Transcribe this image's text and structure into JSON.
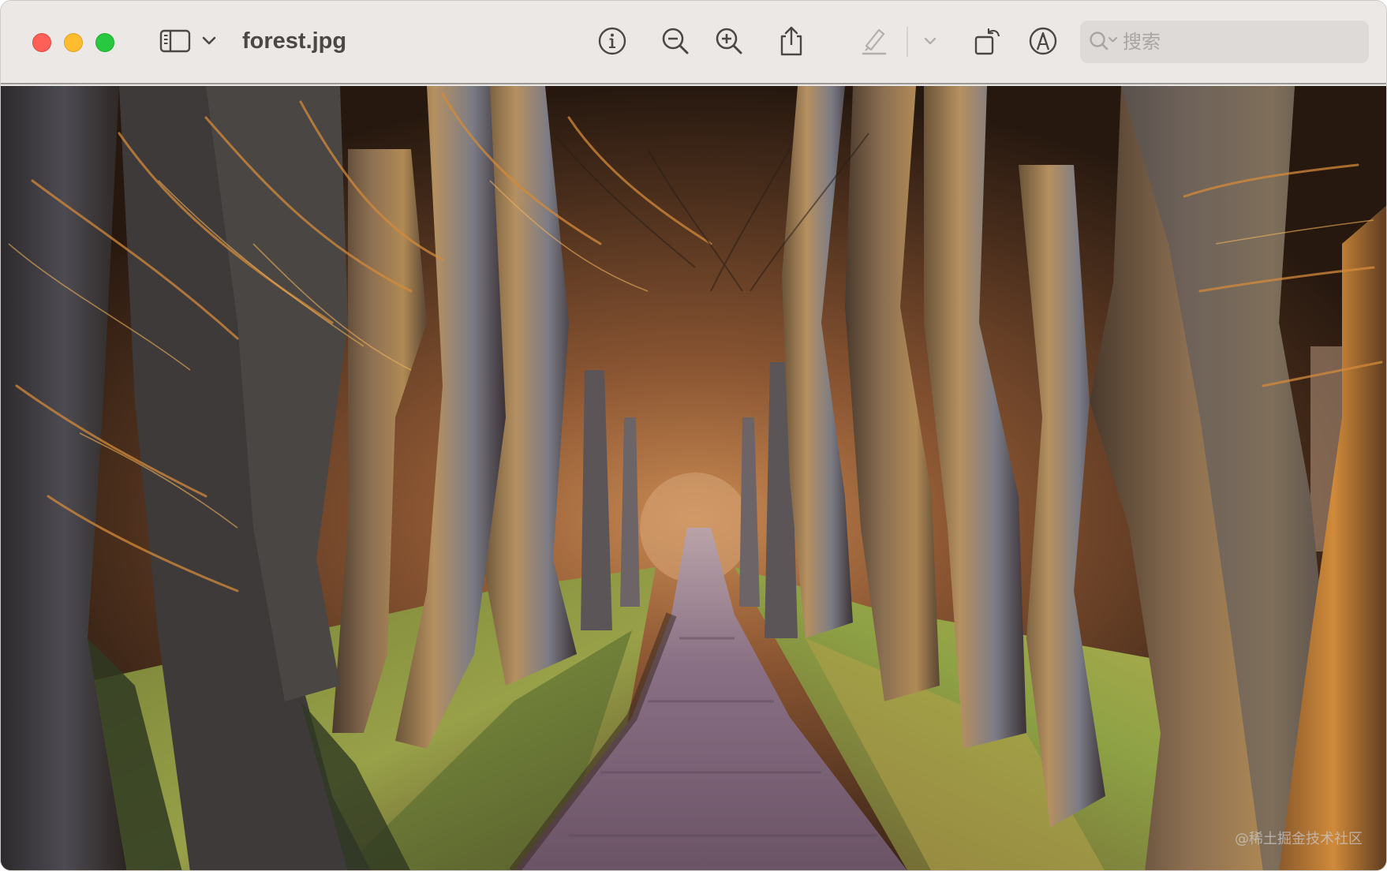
{
  "window": {
    "title": "forest.jpg"
  },
  "toolbar": {
    "icons": [
      "sidebar-icon",
      "chevron-down-icon",
      "info-icon",
      "zoom-out-icon",
      "zoom-in-icon",
      "share-icon",
      "highlighter-icon",
      "chevron-down-icon",
      "rotate-icon",
      "markup-icon"
    ]
  },
  "search": {
    "placeholder": "搜索",
    "value": ""
  },
  "image": {
    "subject": "forest-path",
    "watermark": "@稀土掘金技术社区"
  },
  "colors": {
    "close": "#fe5f57",
    "minimize": "#febc2e",
    "zoom": "#28c840",
    "toolbar_bg": "#ece8e6",
    "icon": "#4a4745",
    "icon_disabled": "#b3afac"
  }
}
